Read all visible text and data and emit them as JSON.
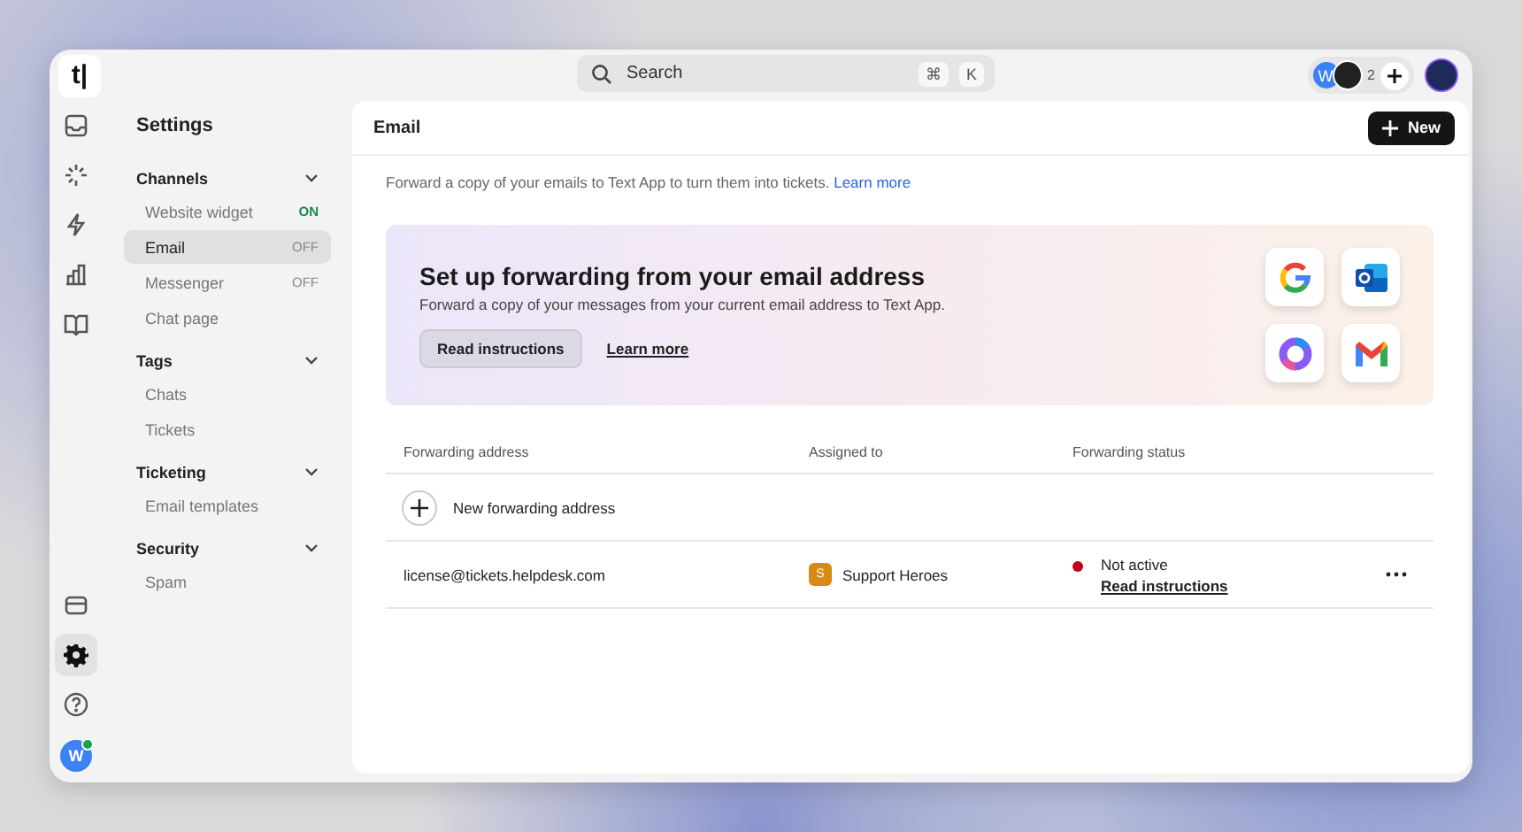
{
  "logo": "t|",
  "search": {
    "placeholder": "Search",
    "keys": [
      "⌘",
      "K"
    ]
  },
  "header": {
    "avatar_initial": "W",
    "count": "2"
  },
  "rail": {
    "top": [
      {
        "kind": "inbox",
        "selected": false
      },
      {
        "kind": "sparkle",
        "selected": false
      },
      {
        "kind": "bolt",
        "selected": false
      },
      {
        "kind": "chart",
        "selected": false
      },
      {
        "kind": "book",
        "selected": false
      }
    ],
    "bottom": [
      {
        "kind": "card",
        "selected": false
      },
      {
        "kind": "gear",
        "selected": true
      },
      {
        "kind": "help",
        "selected": false
      }
    ],
    "user_initial": "W",
    "user_online": true
  },
  "settings": {
    "title": "Settings",
    "sections": [
      {
        "title": "Channels",
        "expanded": true,
        "items": [
          {
            "label": "Website widget",
            "status": "ON",
            "on": true,
            "selected": false
          },
          {
            "label": "Email",
            "status": "OFF",
            "on": false,
            "selected": true
          },
          {
            "label": "Messenger",
            "status": "OFF",
            "on": false,
            "selected": false
          },
          {
            "label": "Chat page",
            "selected": false
          }
        ]
      },
      {
        "title": "Tags",
        "expanded": true,
        "items": [
          {
            "label": "Chats",
            "selected": false
          },
          {
            "label": "Tickets",
            "selected": false
          }
        ]
      },
      {
        "title": "Ticketing",
        "expanded": true,
        "items": [
          {
            "label": "Email templates",
            "selected": false
          }
        ]
      },
      {
        "title": "Security",
        "expanded": true,
        "items": [
          {
            "label": "Spam",
            "selected": false
          }
        ]
      }
    ]
  },
  "page": {
    "title": "Email",
    "new_button": "New",
    "description": "Forward a copy of your emails to Text App to turn them into tickets.",
    "description_link": "Learn more"
  },
  "banner": {
    "title": "Set up forwarding from your email address",
    "text": "Forward a copy of your messages from your current email address to Text App.",
    "primary_button": "Read instructions",
    "link": "Learn more",
    "providers": [
      {
        "kind": "google"
      },
      {
        "kind": "outlook"
      },
      {
        "kind": "copilot"
      },
      {
        "kind": "gmail"
      }
    ]
  },
  "table": {
    "columns": [
      "Forwarding address",
      "Assigned to",
      "Forwarding status"
    ],
    "add_row": "New forwarding address",
    "rows": [
      {
        "address": "license@tickets.helpdesk.com",
        "team": {
          "initial": "S",
          "name": "Support Heroes",
          "color": "#d98a14"
        },
        "status": {
          "label": "Not active",
          "color": "#c0001a",
          "link": "Read instructions"
        }
      }
    ]
  }
}
